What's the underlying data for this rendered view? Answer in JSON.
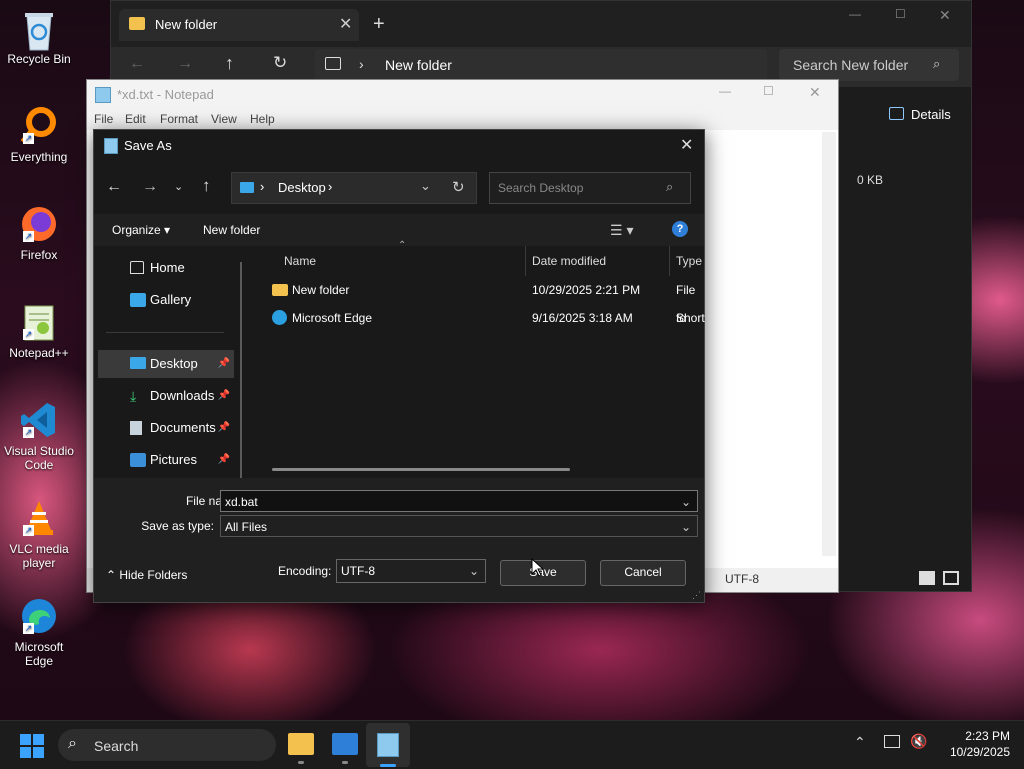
{
  "desktop": {
    "icons": [
      {
        "label": "Recycle Bin",
        "icon": "recycle-bin-icon"
      },
      {
        "label": "Everything",
        "icon": "search-magnifier-icon"
      },
      {
        "label": "Firefox",
        "icon": "firefox-icon"
      },
      {
        "label": "Notepad++",
        "icon": "notepadpp-icon"
      },
      {
        "label": "Visual Studio Code",
        "icon": "vscode-icon"
      },
      {
        "label": "VLC media player",
        "icon": "vlc-icon"
      },
      {
        "label": "Microsoft Edge",
        "icon": "edge-icon"
      }
    ]
  },
  "explorer": {
    "tab_title": "New folder",
    "breadcrumb": "New folder",
    "search_placeholder": "Search New folder",
    "details_label": "Details",
    "size_value": "0 KB"
  },
  "notepad": {
    "title": "*xd.txt - Notepad",
    "menu": [
      "File",
      "Edit",
      "Format",
      "View",
      "Help"
    ],
    "status_encoding": "UTF-8"
  },
  "save_dialog": {
    "title": "Save As",
    "address": "Desktop",
    "search_placeholder": "Search Desktop",
    "organize_label": "Organize",
    "new_folder_label": "New folder",
    "nav": {
      "home": "Home",
      "gallery": "Gallery",
      "desktop": "Desktop",
      "downloads": "Downloads",
      "documents": "Documents",
      "pictures": "Pictures"
    },
    "columns": {
      "name": "Name",
      "date": "Date modified",
      "type": "Type"
    },
    "files": [
      {
        "name": "New folder",
        "date": "10/29/2025 2:21 PM",
        "type": "File fo"
      },
      {
        "name": "Microsoft Edge",
        "date": "9/16/2025 3:18 AM",
        "type": "Short"
      }
    ],
    "file_name_label": "File name:",
    "file_name_value": "xd.bat",
    "save_type_label": "Save as type:",
    "save_type_value": "All Files",
    "hide_folders_label": "Hide Folders",
    "encoding_label": "Encoding:",
    "encoding_value": "UTF-8",
    "save_label": "Save",
    "cancel_label": "Cancel"
  },
  "taskbar": {
    "search_label": "Search",
    "time": "2:23 PM",
    "date": "10/29/2025"
  }
}
